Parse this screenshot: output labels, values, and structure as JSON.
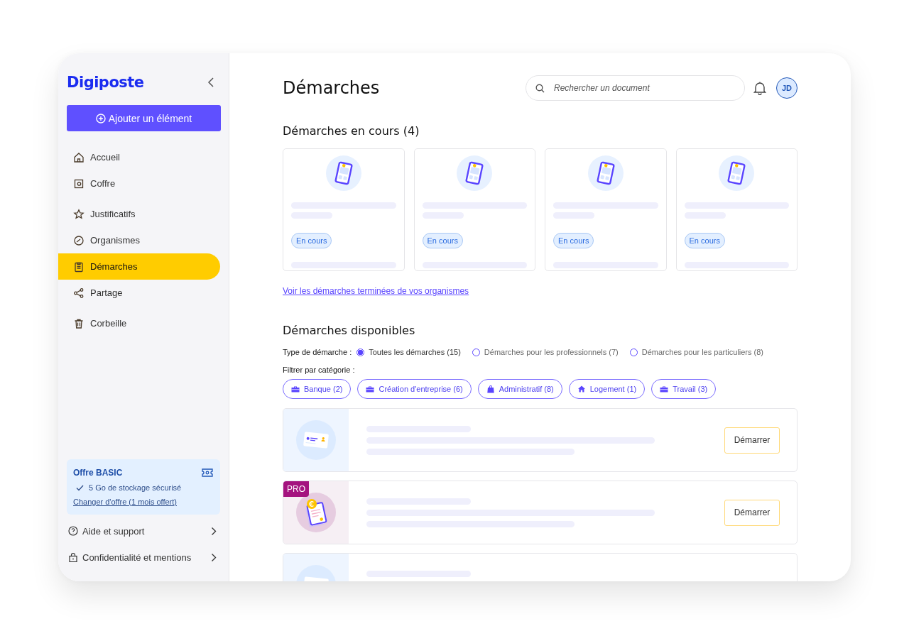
{
  "sidebar": {
    "logo": "Digiposte",
    "add_button": "Ajouter un élément",
    "nav_groups": [
      [
        {
          "label": "Accueil",
          "kind": "home",
          "selected": false
        },
        {
          "label": "Coffre",
          "kind": "safe",
          "selected": false
        }
      ],
      [
        {
          "label": "Justificatifs",
          "kind": "star",
          "selected": false
        },
        {
          "label": "Organismes",
          "kind": "gauge",
          "selected": false
        },
        {
          "label": "Démarches",
          "kind": "clipboard",
          "selected": true
        },
        {
          "label": "Partage",
          "kind": "share",
          "selected": false
        }
      ],
      [
        {
          "label": "Corbeille",
          "kind": "trash",
          "selected": false
        }
      ]
    ],
    "offer": {
      "title": "Offre BASIC",
      "feature": "5 Go de stockage sécurisé",
      "link": "Changer d'offre (1 mois offert)"
    },
    "footer_links": [
      {
        "label": "Aide et support",
        "kind": "help"
      },
      {
        "label": "Confidentialité et mentions",
        "kind": "lock"
      }
    ]
  },
  "header": {
    "title": "Démarches",
    "search": {
      "placeholder": "Rechercher un document"
    },
    "avatar": "JD"
  },
  "in_progress": {
    "title": "Démarches en cours (4)",
    "cards": [
      {
        "status": "En cours"
      },
      {
        "status": "En cours"
      },
      {
        "status": "En cours"
      },
      {
        "status": "En cours"
      }
    ],
    "link": "Voir les démarches terminées de vos organismes"
  },
  "available": {
    "title": "Démarches disponibles",
    "type_label": "Type de démarche :",
    "types": [
      {
        "label": "Toutes les démarches (15)",
        "selected": true
      },
      {
        "label": "Démarches pour les professionnels (7)",
        "selected": false
      },
      {
        "label": "Démarches pour les particuliers (8)",
        "selected": false
      }
    ],
    "category_label": "Filtrer par catégorie :",
    "categories": [
      {
        "label": "Banque (2)",
        "kind": "briefcase"
      },
      {
        "label": "Création d'entreprise (6)",
        "kind": "briefcase"
      },
      {
        "label": "Administratif (8)",
        "kind": "bag"
      },
      {
        "label": "Logement (1)",
        "kind": "house"
      },
      {
        "label": "Travail (3)",
        "kind": "briefcase"
      }
    ],
    "rows": [
      {
        "kind": "id-card",
        "button": "Démarrer"
      },
      {
        "kind": "invoice",
        "badge": "PRO",
        "button": "Démarrer"
      },
      {
        "kind": "id-card"
      }
    ]
  }
}
